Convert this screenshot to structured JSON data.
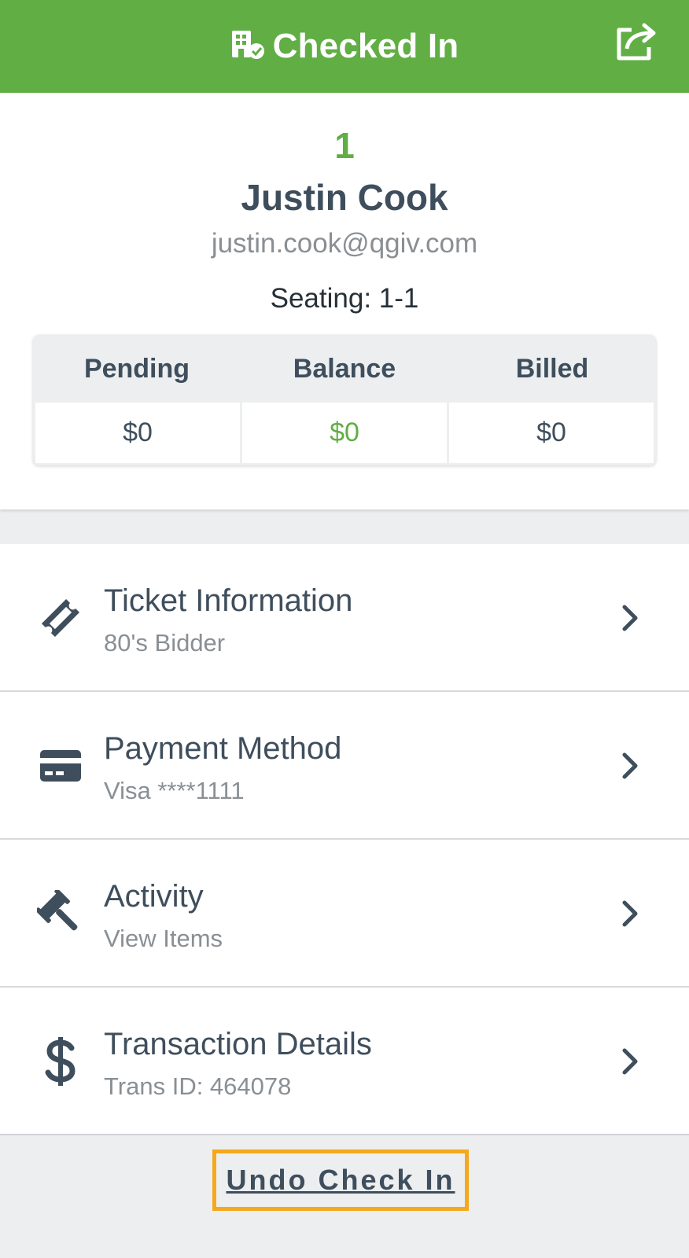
{
  "header": {
    "title": "Checked In",
    "title_icon": "building-check-icon",
    "share_icon": "share-icon",
    "accent_color": "#60ae44"
  },
  "profile": {
    "bidder_number": "1",
    "name": "Justin Cook",
    "email": "justin.cook@qgiv.com",
    "seating": "Seating: 1-1"
  },
  "totals": {
    "headers": [
      "Pending",
      "Balance",
      "Billed"
    ],
    "values": [
      "$0",
      "$0",
      "$0"
    ]
  },
  "menu": [
    {
      "title": "Ticket Information",
      "subtitle": "80's Bidder",
      "icon": "ticket-icon"
    },
    {
      "title": "Payment Method",
      "subtitle": "Visa ****1111",
      "icon": "credit-card-icon"
    },
    {
      "title": "Activity",
      "subtitle": "View Items",
      "icon": "gavel-icon"
    },
    {
      "title": "Transaction Details",
      "subtitle": "Trans ID: 464078",
      "icon": "dollar-icon"
    }
  ],
  "undo_label": "Undo Check In"
}
